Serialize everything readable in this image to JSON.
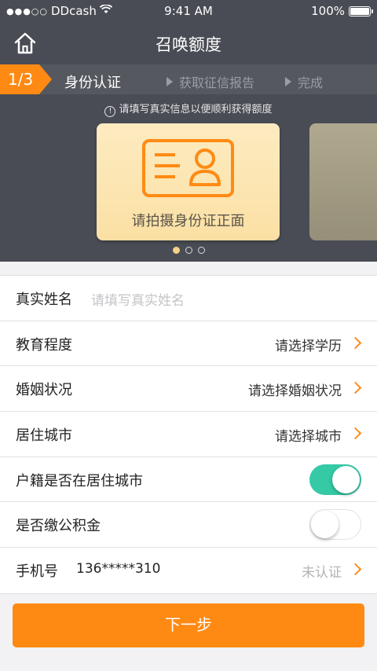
{
  "status_bar": {
    "signal": "●●●○○",
    "carrier": "DDcash",
    "time": "9:41 AM",
    "battery": "100%"
  },
  "nav": {
    "title": "召唤额度",
    "home_icon": "home-icon"
  },
  "steps": {
    "counter": "1/3",
    "current": "身份认证",
    "next": "获取征信报告",
    "last": "完成"
  },
  "hint": "请填写真实信息以便顺利获得额度",
  "card": {
    "label": "请拍摄身份证正面",
    "icon": "id-card-icon"
  },
  "pager": {
    "count": 3,
    "active": 0
  },
  "form": {
    "name_label": "真实姓名",
    "name_placeholder": "请填写真实姓名",
    "education_label": "教育程度",
    "education_value": "请选择学历",
    "marital_label": "婚姻状况",
    "marital_value": "请选择婚姻状况",
    "city_label": "居住城市",
    "city_value": "请选择城市",
    "hukou_label": "户籍是否在居住城市",
    "hukou_on": true,
    "fund_label": "是否缴公积金",
    "fund_on": false,
    "phone_label": "手机号",
    "phone_value": "136*****310",
    "phone_status": "未认证"
  },
  "next_button": "下一步",
  "colors": {
    "header_bg": "#494c54",
    "accent_orange": "#ff8a13",
    "toggle_on": "#35c9a6"
  }
}
